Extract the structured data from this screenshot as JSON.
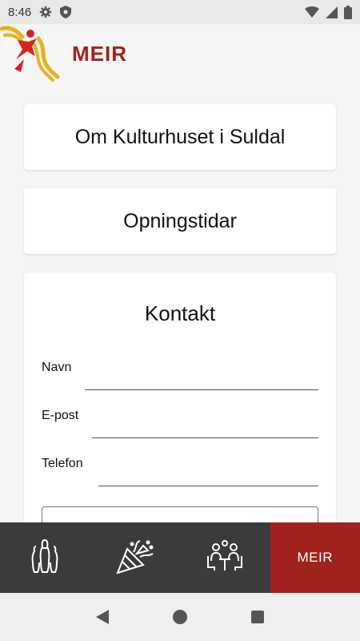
{
  "status_bar": {
    "time": "8:46",
    "icons": [
      "settings-icon",
      "shield-icon",
      "wifi-icon",
      "signal-icon",
      "battery-icon"
    ]
  },
  "header": {
    "title": "MEIR",
    "logo": "kulturhuset-logo"
  },
  "menu": {
    "about_label": "Om Kulturhuset i Suldal",
    "hours_label": "Opningstidar"
  },
  "contact": {
    "title": "Kontakt",
    "fields": [
      {
        "label": "Navn",
        "value": ""
      },
      {
        "label": "E-post",
        "value": ""
      },
      {
        "label": "Telefon",
        "value": ""
      }
    ],
    "message": ""
  },
  "bottom_nav": {
    "items": [
      {
        "icon": "bowling-pins-icon"
      },
      {
        "icon": "party-popper-icon"
      },
      {
        "icon": "meeting-people-icon"
      },
      {
        "label": "MEIR"
      }
    ],
    "active_index": 3
  },
  "colors": {
    "accent": "#a0221c",
    "nav_bg": "#3b3b3b",
    "page_bg": "#f5f5f5"
  }
}
